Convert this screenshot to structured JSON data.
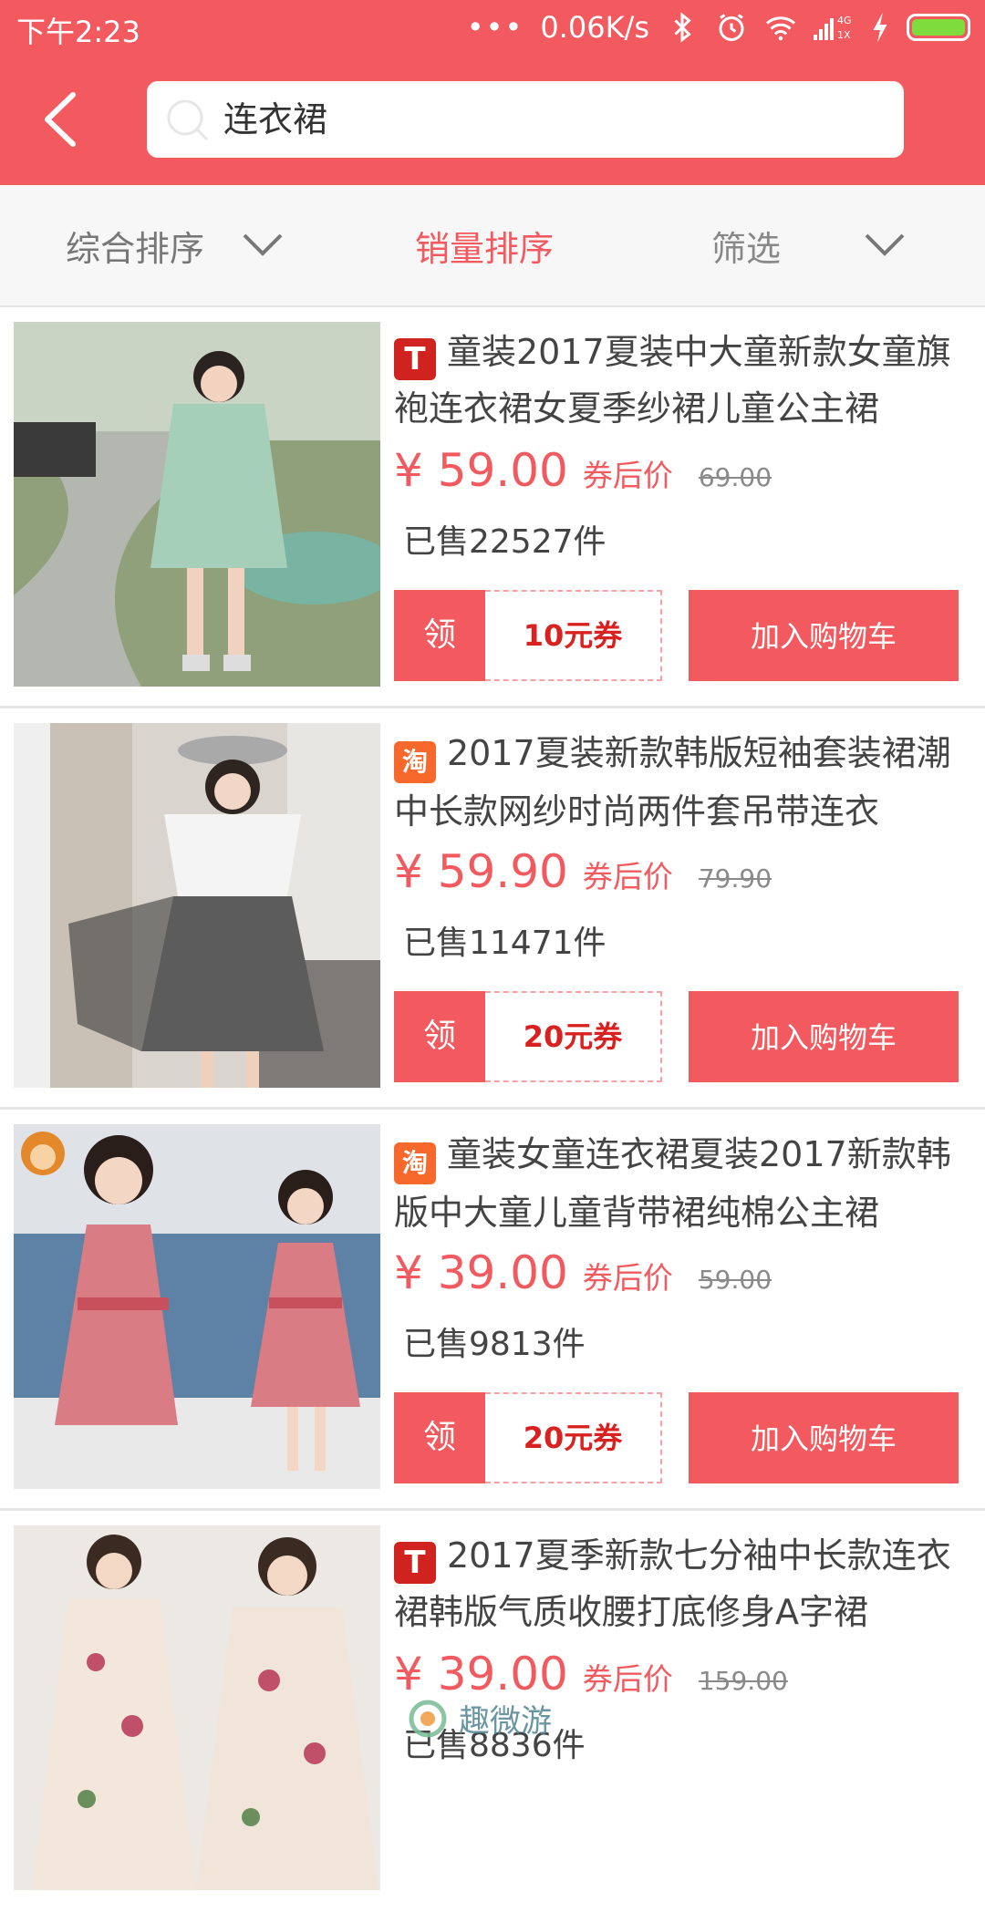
{
  "status_bar": {
    "time": "下午2:23",
    "dots": "•••",
    "speed": "0.06K/s",
    "net_top": "4G",
    "net_bottom": "1X"
  },
  "search": {
    "value": "连衣裙"
  },
  "sort_bar": {
    "default_label": "综合排序",
    "sales_label": "销量排序",
    "filter_label": "筛选",
    "active": "sales"
  },
  "colors": {
    "brand": "#f25a5f",
    "tmall": "#d0231f",
    "taobao": "#f6682b"
  },
  "products": [
    {
      "badge": "T",
      "badge_type": "tmall",
      "title": "童装2017夏装中大童新款女童旗袍连衣裙女夏季纱裙儿童公主裙",
      "price": "¥ 59.00",
      "coupon_price_label": "券后价",
      "original_price": "69.00",
      "sold": "已售22527件",
      "coupon_left": "领",
      "coupon_right": "10元券",
      "cart": "加入购物车"
    },
    {
      "badge": "淘",
      "badge_type": "taobao",
      "title": "2017夏装新款韩版短袖套装裙潮中长款网纱时尚两件套吊带连衣",
      "price": "¥ 59.90",
      "coupon_price_label": "券后价",
      "original_price": "79.90",
      "sold": "已售11471件",
      "coupon_left": "领",
      "coupon_right": "20元券",
      "cart": "加入购物车"
    },
    {
      "badge": "淘",
      "badge_type": "taobao",
      "title": "童装女童连衣裙夏装2017新款韩版中大童儿童背带裙纯棉公主裙",
      "price": "¥ 39.00",
      "coupon_price_label": "券后价",
      "original_price": "59.00",
      "sold": "已售9813件",
      "coupon_left": "领",
      "coupon_right": "20元券",
      "cart": "加入购物车"
    },
    {
      "badge": "T",
      "badge_type": "tmall",
      "title": "2017夏季新款七分袖中长款连衣裙韩版气质收腰打底修身A字裙",
      "price": "¥ 39.00",
      "coupon_price_label": "券后价",
      "original_price": "159.00",
      "sold": "已售8836件"
    }
  ],
  "watermark": "趣微游"
}
